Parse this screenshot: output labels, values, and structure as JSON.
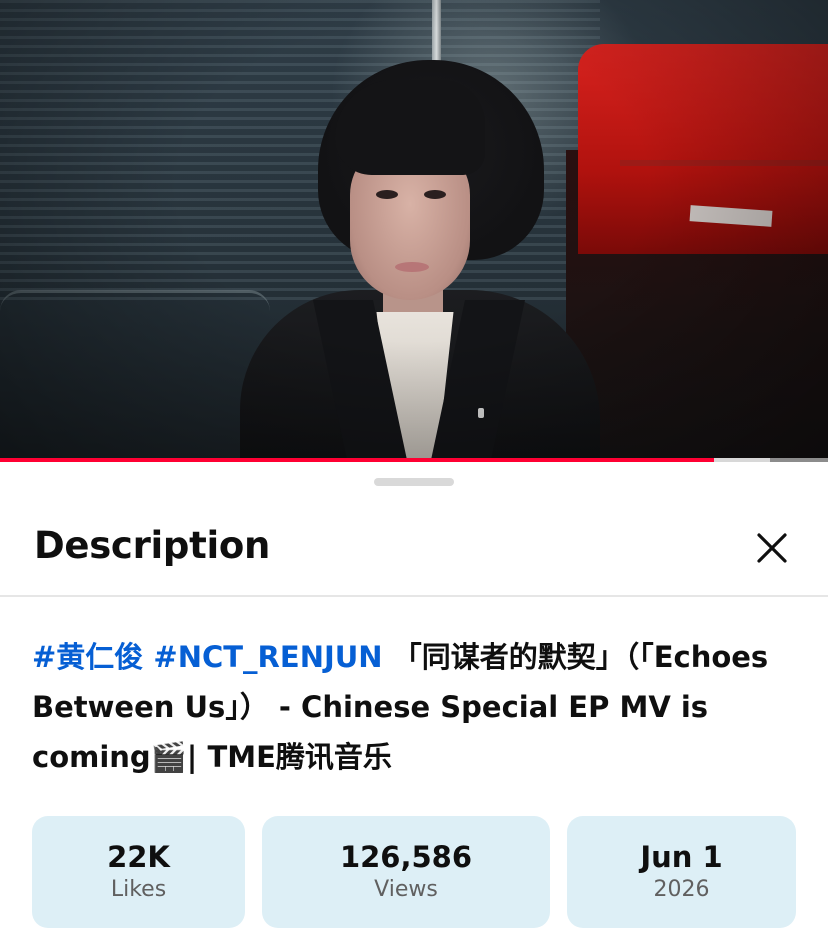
{
  "video": {
    "progress": 0.862,
    "buffered": 0.93
  },
  "sheet": {
    "title": "Description",
    "close_icon": "close-icon"
  },
  "description": {
    "hashtag_1": "#黄仁俊",
    "hashtag_2": "#NCT_RENJUN",
    "text": "「同谋者的默契」（「Echoes Between Us」） - Chinese Special EP MV is coming🎬| TME腾讯音乐"
  },
  "stats": {
    "likes_value": "22K",
    "likes_label": "Likes",
    "views_value": "126,586",
    "views_label": "Views",
    "date_value": "Jun 1",
    "date_year": "2026"
  },
  "colors": {
    "accent_link": "#065fd4",
    "progress_red": "#ff0033",
    "stat_bg": "#ddeff6"
  }
}
